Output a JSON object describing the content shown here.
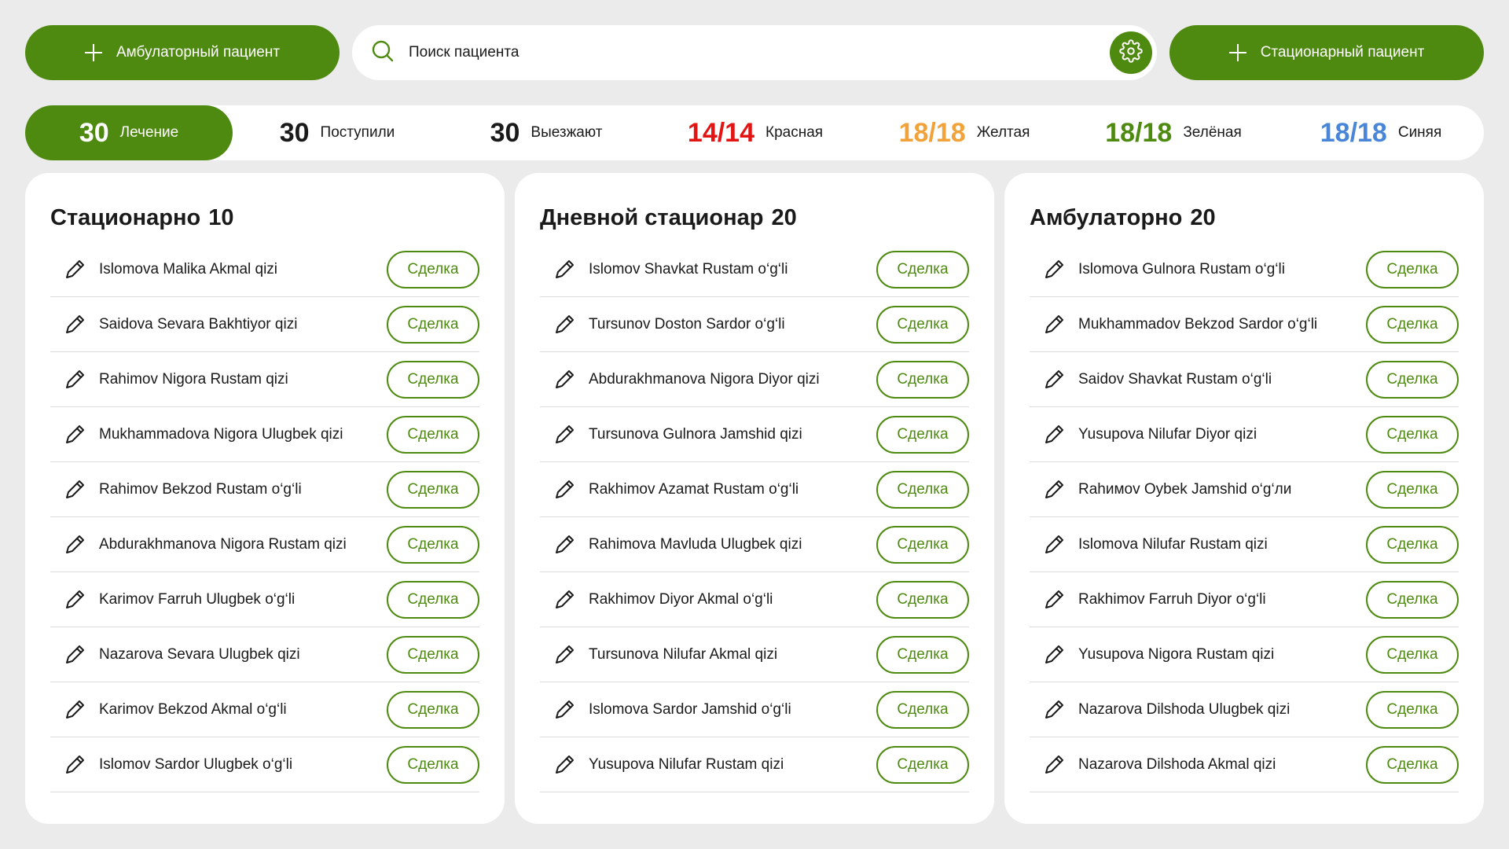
{
  "topbar": {
    "outpatient_label": "Амбулаторный пациент",
    "inpatient_label": "Стационарный пациент",
    "search_placeholder": "Поиск пациента"
  },
  "filters": [
    {
      "count": "30",
      "label": "Лечение",
      "color": "#ffffff",
      "active": true
    },
    {
      "count": "30",
      "label": "Поступили",
      "color": "#1a1a1a",
      "active": false
    },
    {
      "count": "30",
      "label": "Выезжают",
      "color": "#1a1a1a",
      "active": false
    },
    {
      "count": "14/14",
      "label": "Красная",
      "color": "#e31414",
      "active": false
    },
    {
      "count": "18/18",
      "label": "Желтая",
      "color": "#f2a23a",
      "active": false
    },
    {
      "count": "18/18",
      "label": "Зелёная",
      "color": "#4e8a10",
      "active": false
    },
    {
      "count": "18/18",
      "label": "Синяя",
      "color": "#4a86d8",
      "active": false
    }
  ],
  "action_label": "Сделка",
  "panels": [
    {
      "title": "Стационарно",
      "count": "10",
      "patients": [
        "Islomova Malika Akmal qizi",
        "Saidova Sevara Bakhtiyor qizi",
        "Rahimov Nigora Rustam qizi",
        "Mukhammadova Nigora Ulugbek qizi",
        "Rahimov Bekzod Rustam o‘g‘li",
        "Abdurakhmanova Nigora Rustam qizi",
        "Karimov Farruh Ulugbek o‘g‘li",
        "Nazarova Sevara Ulugbek qizi",
        "Karimov Bekzod Akmal o‘g‘li",
        "Islomov Sardor Ulugbek o‘g‘li"
      ]
    },
    {
      "title": "Дневной стационар",
      "count": "20",
      "patients": [
        "Islomov Shavkat Rustam o‘g‘li",
        "Tursunov Doston Sardor o‘g‘li",
        "Abdurakhmanova Nigora Diyor qizi",
        "Tursunova Gulnora Jamshid qizi",
        "Rakhimov Azamat Rustam o‘g‘li",
        "Rahimova Mavluda Ulugbek qizi",
        "Rakhimov Diyor Akmal o‘g‘li",
        "Tursunova Nilufar Akmal qizi",
        "Islomova Sardor Jamshid o‘g‘li",
        "Yusupova Nilufar Rustam qizi"
      ]
    },
    {
      "title": "Амбулаторно",
      "count": "20",
      "patients": [
        "Islomova Gulnora Rustam o‘g‘li",
        "Mukhammadov Bekzod Sardor o‘g‘li",
        "Saidov Shavkat Rustam o‘g‘li",
        "Yusupova Nilufar Diyor qizi",
        "Rahимov Oybek Jamshid o‘g‘ли",
        "Islomova Nilufar Rustam qizi",
        "Rakhimov Farruh Diyor o‘g‘li",
        "Yusupova Nigora Rustam qizi",
        "Nazarova Dilshoda Ulugbek qizi",
        "Nazarova Dilshoda Akmal qizi"
      ]
    }
  ]
}
